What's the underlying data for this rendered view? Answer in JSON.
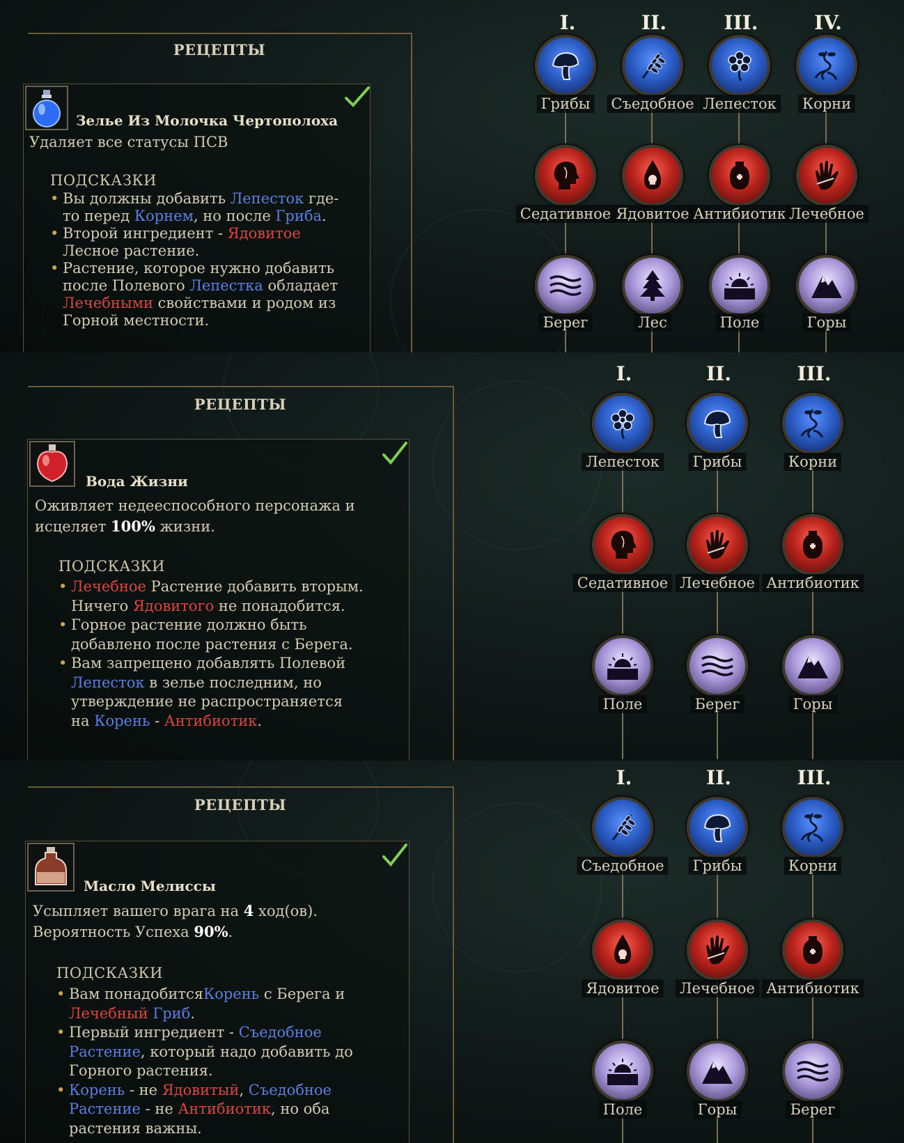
{
  "sections": [
    {
      "recipes_title": "РЕЦЕПТЫ",
      "potion_name": "Зелье Из Молочка Чертополоха",
      "potion_icon": "blue-potion-icon",
      "description": "Удаляет все статусы ПСВ",
      "hints_title": "ПОДСКАЗКИ",
      "hints": [
        "Вы должны добавить Лепесток где-то перед Корнем, но после Гриба.",
        "Второй ингредиент - Ядовитое Лесное растение.",
        "Растение, которое нужно добавить после Полевого Лепестка обладает Лечебными свойствами и родом из Горной местности."
      ],
      "columns": [
        "I.",
        "II.",
        "III.",
        "IV."
      ],
      "rows": [
        [
          "Грибы",
          "Съедобное",
          "Лепесток",
          "Корни"
        ],
        [
          "Седативное",
          "Ядовитое",
          "Антибиотик",
          "Лечебное"
        ],
        [
          "Берег",
          "Лес",
          "Поле",
          "Горы"
        ]
      ],
      "icons": [
        [
          "mushroom-icon",
          "wheat-icon",
          "flower-icon",
          "root-icon"
        ],
        [
          "head-icon",
          "poison-drop-icon",
          "jar-cross-icon",
          "hand-icon"
        ],
        [
          "waves-icon",
          "tree-icon",
          "sunrise-icon",
          "mountain-icon"
        ]
      ]
    },
    {
      "recipes_title": "РЕЦЕПТЫ",
      "potion_name": "Вода Жизни",
      "potion_icon": "red-potion-icon",
      "description_a": "Оживляет недееспособного персонажа и исцеляет ",
      "description_bold": "100%",
      "description_b": " жизни.",
      "hints_title": "ПОДСКАЗКИ",
      "hints": [
        "Лечебное Растение добавить вторым. Ничего Ядовитого не понадобится.",
        "Горное растение должно быть добавлено после растения с Берега.",
        "Вам запрещено добавлять Полевой Лепесток в зелье последним, но утверждение не распространяется на Корень - Антибиотик."
      ],
      "columns": [
        "I.",
        "II.",
        "III."
      ],
      "rows": [
        [
          "Лепесток",
          "Грибы",
          "Корни"
        ],
        [
          "Седативное",
          "Лечебное",
          "Антибиотик"
        ],
        [
          "Поле",
          "Берег",
          "Горы"
        ]
      ],
      "icons": [
        [
          "flower-icon",
          "mushroom-icon",
          "root-icon"
        ],
        [
          "head-icon",
          "hand-icon",
          "jar-cross-icon"
        ],
        [
          "sunrise-icon",
          "waves-icon",
          "mountain-icon"
        ]
      ]
    },
    {
      "recipes_title": "РЕЦЕПТЫ",
      "potion_name": "Масло Мелиссы",
      "potion_icon": "oil-flask-icon",
      "description_a": "Усыпляет вашего врага на ",
      "description_bold": "4",
      "description_b": " ход(ов).",
      "description_c": "Вероятность Успеха ",
      "description_bold2": "90%",
      "description_d": ".",
      "hints_title": "ПОДСКАЗКИ",
      "hints": [
        "Вам понадобитсяКорень с Берега и Лечебный Гриб.",
        "Первый ингредиент - Съедобное Растение, который надо добавить до Горного растения.",
        "Корень - не Ядовитый, Съедобное Растение - не Антибиотик, но оба растения важны."
      ],
      "columns": [
        "I.",
        "II.",
        "III."
      ],
      "rows": [
        [
          "Съедобное",
          "Грибы",
          "Корни"
        ],
        [
          "Ядовитое",
          "Лечебное",
          "Антибиотик"
        ],
        [
          "Поле",
          "Горы",
          "Берег"
        ]
      ],
      "icons": [
        [
          "wheat-icon",
          "mushroom-icon",
          "root-icon"
        ],
        [
          "poison-drop-icon",
          "hand-icon",
          "jar-cross-icon"
        ],
        [
          "sunrise-icon",
          "mountain-icon",
          "waves-icon"
        ]
      ]
    }
  ],
  "colors": {
    "blue_highlight": "#5a7fe0",
    "red_highlight": "#d9473e",
    "purple_highlight": "#b8aee8",
    "check": "#7fcf57"
  }
}
